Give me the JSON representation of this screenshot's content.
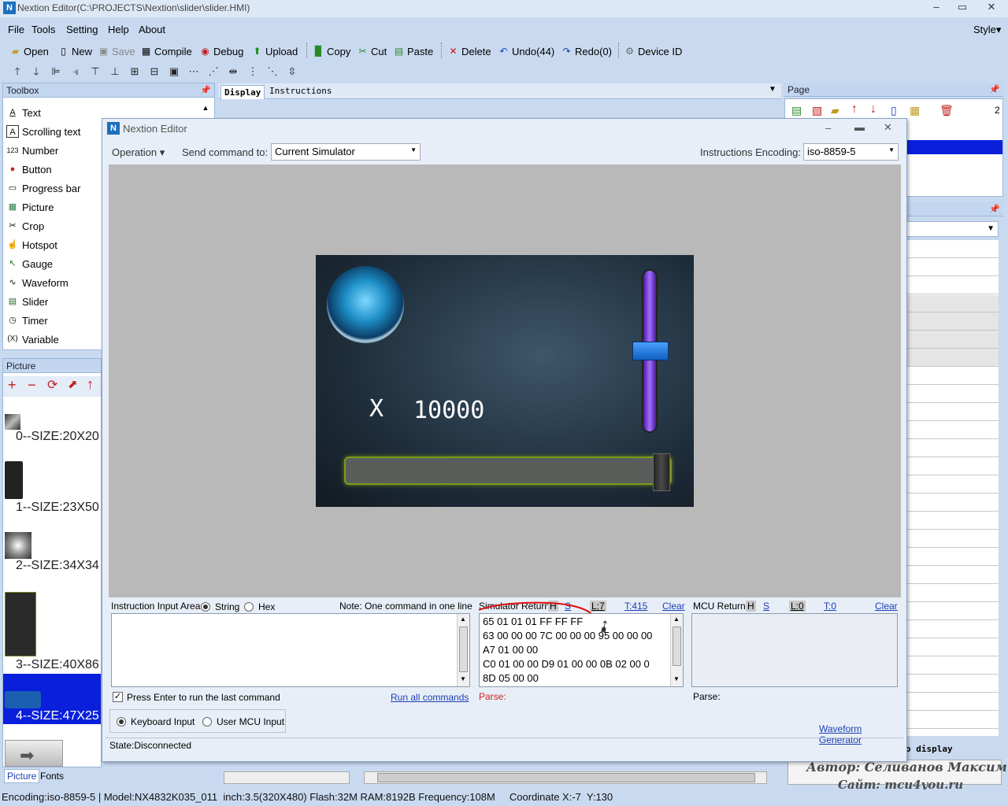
{
  "window": {
    "title": "Nextion Editor(C:\\PROJECTS\\Nextion\\slider\\slider.HMI)",
    "logo": "N"
  },
  "menu": {
    "file": "File",
    "tools": "Tools",
    "setting": "Setting",
    "help": "Help",
    "about": "About",
    "style": "Style"
  },
  "toolbar": {
    "open": "Open",
    "new": "New",
    "save": "Save",
    "compile": "Compile",
    "debug": "Debug",
    "upload": "Upload",
    "copy": "Copy",
    "cut": "Cut",
    "paste": "Paste",
    "delete": "Delete",
    "undo": "Undo(44)",
    "redo": "Redo(0)",
    "device_id": "Device  ID"
  },
  "toolbox": {
    "title": "Toolbox",
    "items": [
      {
        "icon": "A",
        "label": "Text"
      },
      {
        "icon": "A",
        "label": "Scrolling text"
      },
      {
        "icon": "123",
        "label": "Number"
      },
      {
        "icon": "●",
        "label": "Button"
      },
      {
        "icon": "▭",
        "label": "Progress bar"
      },
      {
        "icon": "▦",
        "label": "Picture"
      },
      {
        "icon": "✂",
        "label": "Crop"
      },
      {
        "icon": "☝",
        "label": "Hotspot"
      },
      {
        "icon": "↖",
        "label": "Gauge"
      },
      {
        "icon": "∿",
        "label": "Waveform"
      },
      {
        "icon": "▤",
        "label": "Slider"
      },
      {
        "icon": "◷",
        "label": "Timer"
      },
      {
        "icon": "(X)",
        "label": "Variable"
      }
    ]
  },
  "tabs": {
    "display": "Display",
    "instructions": "Instructions"
  },
  "picture_panel": {
    "title": "Picture",
    "items": [
      "0--SIZE:20X20",
      "1--SIZE:23X50",
      "2--SIZE:34X34",
      "3--SIZE:40X86",
      "4--SIZE:47X25"
    ]
  },
  "bottom_tabs": {
    "picture": "Picture",
    "fonts": "Fonts"
  },
  "page_panel": {
    "title": "Page",
    "count": "2"
  },
  "dialog": {
    "title": "Nextion Editor",
    "operation": "Operation",
    "send_command_label": "Send command to:",
    "send_command_value": "Current Simulator",
    "encoding_label": "Instructions Encoding:",
    "encoding_value": "iso-8859-5",
    "screen": {
      "x_label": "X",
      "number": "10000",
      "vertical_slider_level": 0.5,
      "horizontal_slider_level": 1.0
    },
    "instruction": {
      "label": "Instruction Input Area:",
      "string": "String",
      "hex": "Hex",
      "note": "Note: One command in one line",
      "press_enter": "Press Enter to run the last command",
      "run_all": "Run all commands",
      "keyboard": "Keyboard Input",
      "user_mcu": "User MCU Input"
    },
    "sim_return": {
      "label": "Simulator Return:",
      "h": "H",
      "s": "S",
      "l": "L:7",
      "t": "T:415",
      "clear": "Clear",
      "lines": [
        "65 01 01 01 FF FF FF",
        "63 00 00 00 7C 00 00 00 95 00 00 00",
        "A7 01 00 00",
        "C0 01 00 00 D9 01 00 00 0B 02 00 0",
        "8D 05 00 00"
      ],
      "parse": "Parse:"
    },
    "mcu_return": {
      "label": "MCU Return:",
      "h": "H",
      "s": "S",
      "l": "L:0",
      "t": "T:0",
      "clear": "Clear",
      "parse": "Parse:"
    },
    "waveform": "Waveform Generator",
    "state": "State:Disconnected"
  },
  "watermark": {
    "line1": "Автор: Селиванов Максим",
    "line2": "Сайт: mcu4you.ru",
    "partial": "o display"
  },
  "status": "Encoding:iso-8859-5 | Model:NX4832K035_011  inch:3.5(320X480) Flash:32M RAM:8192B Frequency:108M     Coordinate X:-7  Y:130"
}
